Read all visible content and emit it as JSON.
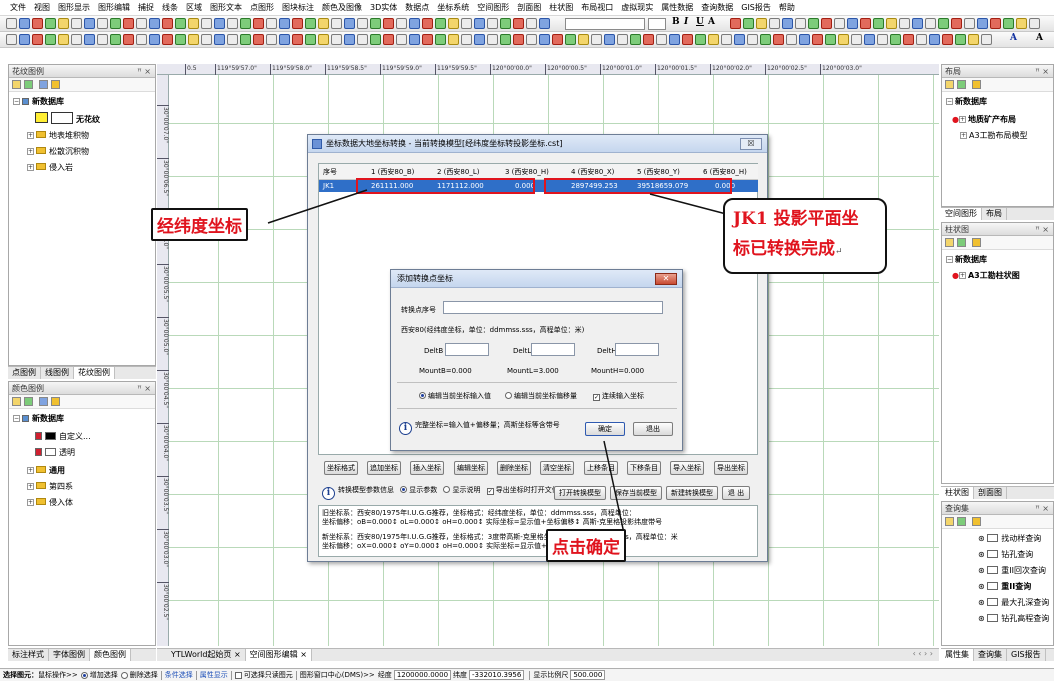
{
  "menubar": {
    "items": [
      "文件",
      "视图",
      "图形显示",
      "图形编辑",
      "捕捉",
      "线条",
      "区域",
      "图形文本",
      "点图形",
      "图块标注",
      "颜色及图像",
      "3D实体",
      "数据点",
      "坐标系统",
      "空间图形",
      "剖面图",
      "柱状图",
      "布局视口",
      "虚拟现实",
      "属性数据",
      "查询数据",
      "GIS报告",
      "帮助"
    ]
  },
  "toolbar": {
    "bold": "B",
    "italic": "I",
    "underline": "U",
    "font_a": "A",
    "right_a": "A",
    "right_abc": "A"
  },
  "left_panel": {
    "title": "花纹图例",
    "pin": "ꟸ ×",
    "tree": {
      "root": "新数据库",
      "selected": "无花纹",
      "items": [
        "地表堆积物",
        "松散沉积物",
        "侵入岩"
      ]
    },
    "tabs": [
      "点图例",
      "线图例",
      "花纹图例"
    ]
  },
  "color_panel": {
    "title": "颜色图例",
    "pin": "ꟸ ×",
    "tree": {
      "root": "新数据库",
      "custom": "自定义...",
      "transparent": "透明",
      "folders": [
        "通用",
        "第四系",
        "侵入体"
      ]
    },
    "tabs": [
      "标注样式",
      "字体图例",
      "颜色图例"
    ]
  },
  "right_panel": {
    "title": "布局",
    "pin": "ꟸ ×",
    "root": "新数据库",
    "item1": "地质矿产布局",
    "item2": "A3工勘布局模型",
    "tabs": [
      "空间图形",
      "布局"
    ]
  },
  "right_panel2": {
    "title": "柱状图",
    "pin": "ꟸ ×",
    "root": "新数据库",
    "item1": "A3工勘柱状图",
    "tabs": [
      "柱状图",
      "剖面图"
    ]
  },
  "right_panel3": {
    "title": "查询集",
    "pin": "ꟸ ×",
    "items": [
      "找动样查询",
      "钻孔查询",
      "重II回次查询",
      "重II查询",
      "最大孔深查询",
      "钻孔高程查询"
    ],
    "tabs": [
      "属性集",
      "查询集",
      "GIS报告"
    ]
  },
  "canvas": {
    "top_ruler": [
      "0.5",
      "119°59'57.0\"",
      "119°59'58.0\"",
      "119°59'58.5\"",
      "119°59'59.0\"",
      "119°59'59.5\"",
      "120°00'00.0\"",
      "120°00'00.5\"",
      "120°00'01.0\"",
      "120°00'01.5\"",
      "120°00'02.0\"",
      "120°00'02.5\"",
      "120°00'03.0\""
    ],
    "left_ruler": [
      "30°00'07.0\"",
      "30°00'06.5\"",
      "30°00'06.0\"",
      "30°00'05.5\"",
      "30°00'05.0\"",
      "30°00'04.5\"",
      "30°00'04.0\"",
      "30°00'03.5\"",
      "30°00'03.0\"",
      "30°00'02.5\""
    ],
    "tabs": [
      "YTLWorld起始页 ×",
      "空间图形编辑 ×"
    ],
    "scroll_arrows": "‹ ‹ › ›"
  },
  "main_dialog": {
    "title": "坐标数据大地坐标转换 - 当前转换模型[经纬度坐标转投影坐标.cst]",
    "close": "☒",
    "columns": [
      "序号",
      "1 (西安80_B)",
      "2 (西安80_L)",
      "3 (西安80_H)",
      "4 (西安80_X)",
      "5 (西安80_Y)",
      "6 (西安80_H)"
    ],
    "row": [
      "JK1",
      "261111.000",
      "1171112.000",
      "0.000",
      "2897499.253",
      "39518659.079",
      "0.000"
    ],
    "buttons": [
      "坐标格式",
      "追加坐标",
      "插入坐标",
      "编辑坐标",
      "删除坐标",
      "清空坐标",
      "上移条目",
      "下移条目",
      "导入坐标",
      "导出坐标"
    ],
    "info_label": "转换模型参数信息",
    "show_params": "显示参数",
    "show_desc": "显示说明",
    "open_after_export": "导出坐标时打开文件",
    "open_model": "打开转换模型",
    "save_model": "保存当前模型",
    "new_model": "新建转换模型",
    "exit": "退 出",
    "old_system": "旧坐标系：西安80/1975年I.U.G.G推荐，坐标格式：经纬度坐标，单位：ddmmss.sss，高程单位：",
    "old_offset": "坐标偏移：oB=0.000↕ oL=0.000↕ oH=0.000↕ 实际坐标=显示值+坐标偏移↕ 高斯-克里格投影纬度带号",
    "new_system": "新坐标系：西安80/1975年I.U.G.G推荐，坐标格式：3度带高斯-克里格坐标，单位：ddmmss.sss，高程单位：米",
    "new_offset": "坐标偏移：oX=0.000↕ oY=0.000↕ oH=0.000↕ 实际坐标=显示值+坐标偏移↕"
  },
  "sub_dialog": {
    "title": "添加转换点坐标",
    "close": "✕",
    "id_label": "转换点序号",
    "desc": "西安80(经纬度坐标，单位：ddmmss.sss，高程单位：米)",
    "delta_b": "DeltB",
    "delta_l": "DeltL",
    "delta_h": "DeltH",
    "mount_b": "MountB=0.000",
    "mount_l": "MountL=3.000",
    "mount_h": "MountH=0.000",
    "radio_input": "编辑当前坐标输入值",
    "radio_offset": "编辑当前坐标偏移量",
    "continuous": "连续输入坐标",
    "hint": "完整坐标=输入值+偏移量；高斯坐标等含带号",
    "ok": "确定",
    "cancel": "退出"
  },
  "callouts": {
    "latlon": "经纬度坐标",
    "jk1": "JK1 投影平面坐",
    "done": "标已转换完成",
    "click_ok": "点击确定",
    "mark": "↵"
  },
  "statusbar": {
    "label": "选择图元：",
    "mode": "鼠标操作>>",
    "add_select": "增加选择",
    "del_select": "删除选择",
    "cond_select": "条件选择",
    "attr_show": "属性显示",
    "only_visible": "可选择只读图元",
    "center_label": "图形窗口中心(DMS)>>",
    "lon_label": "经度",
    "lon": "1200000.0000",
    "lat_label": "纬度",
    "lat": "-332010.3956",
    "scale_label": "显示比例尺",
    "scale": "500.000"
  }
}
